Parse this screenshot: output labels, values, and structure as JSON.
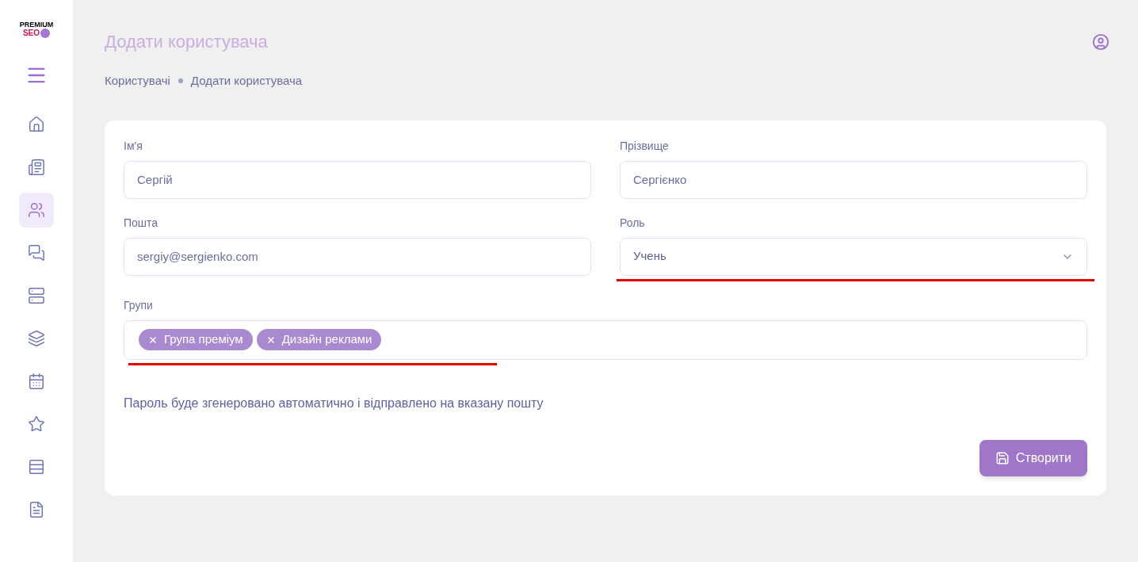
{
  "logo": {
    "line_1": "PREMIUM",
    "line_2": "SEO"
  },
  "sidebar": {
    "items": [
      {
        "selected": false
      },
      {
        "selected": false
      },
      {
        "selected": true
      },
      {
        "selected": false
      },
      {
        "selected": false
      },
      {
        "selected": false
      },
      {
        "selected": false
      },
      {
        "selected": false
      },
      {
        "selected": false
      },
      {
        "selected": false
      }
    ]
  },
  "header": {
    "title": "Додати користувача"
  },
  "breadcrumbs": [
    "Користувачі",
    "Додати користувача"
  ],
  "form": {
    "fields": [
      {
        "kind": "text",
        "label": "Ім'я",
        "value": "Сергій"
      },
      {
        "kind": "text",
        "label": "Прізвище",
        "value": "Сергієнко"
      },
      {
        "kind": "text",
        "label": "Пошта",
        "value": "sergiy@sergienko.com"
      },
      {
        "kind": "select",
        "label": "Роль",
        "value": "Учень",
        "underlined": true
      },
      {
        "kind": "tags",
        "label": "Групи",
        "tags": [
          "Група преміум",
          "Дизайн реклами"
        ],
        "underlined": true
      }
    ],
    "note": "Пароль буде згенеровано автоматично і відправлено на вказану пошту",
    "submit": "Створити"
  }
}
